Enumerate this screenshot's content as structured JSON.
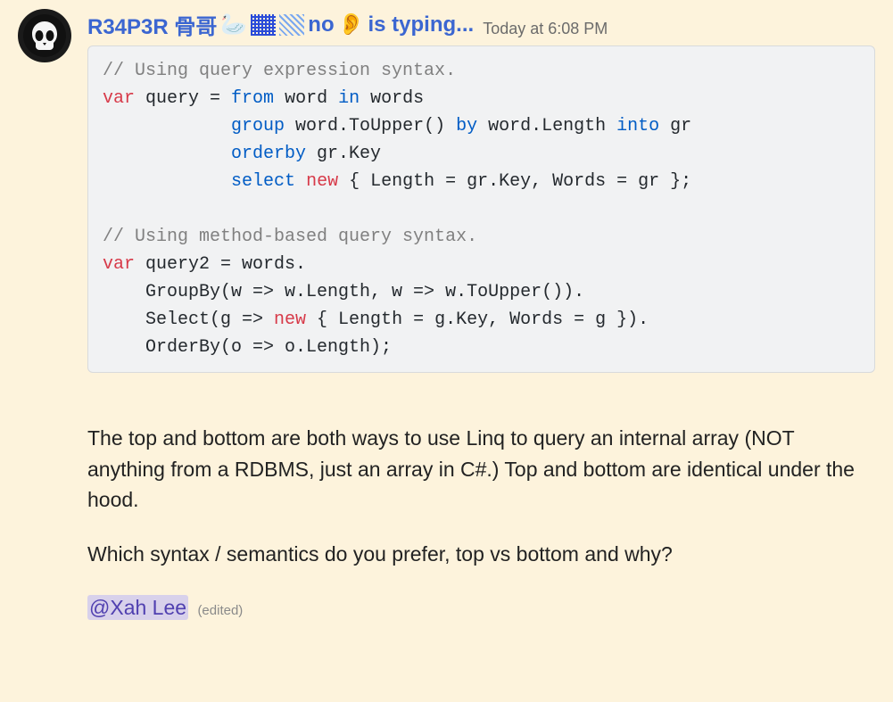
{
  "message": {
    "username_parts": {
      "name": "R34P3R 骨哥",
      "swan": "🦢",
      "no": "no",
      "ear": "👂",
      "typing": "is typing..."
    },
    "timestamp": "Today at 6:08 PM",
    "code": {
      "c1": "// Using query expression syntax.",
      "l2a": "var",
      "l2b": " query = ",
      "l2c": "from",
      "l2d": " word ",
      "l2e": "in",
      "l2f": " words",
      "l3a": "            ",
      "l3b": "group",
      "l3c": " word.ToUpper() ",
      "l3d": "by",
      "l3e": " word.Length ",
      "l3f": "into",
      "l3g": " gr",
      "l4a": "            ",
      "l4b": "orderby",
      "l4c": " gr.Key",
      "l5a": "            ",
      "l5b": "select",
      "l5c": " ",
      "l5d": "new",
      "l5e": " { Length = gr.Key, Words = gr };",
      "blank": "",
      "c2": "// Using method-based query syntax.",
      "l7a": "var",
      "l7b": " query2 = words.",
      "l8": "    GroupBy(w => w.Length, w => w.ToUpper()).",
      "l9a": "    Select(g => ",
      "l9b": "new",
      "l9c": " { Length = g.Key, Words = g }).",
      "l10": "    OrderBy(o => o.Length);"
    },
    "para1": "The top and bottom are both ways to use Linq to query an internal array (NOT anything from a RDBMS, just an array in C#.) Top and bottom are identical under the hood.",
    "para2": "Which syntax / semantics do you prefer, top vs bottom and why?",
    "mention": "@Xah Lee",
    "edited": "(edited)"
  }
}
